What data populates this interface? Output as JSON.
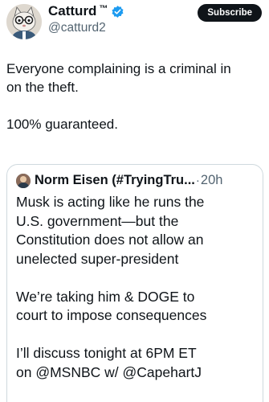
{
  "author": {
    "display_name": "Catturd",
    "trademark": "™",
    "handle": "@catturd2",
    "verified_icon": "verified-badge-icon",
    "avatar_icon": "cat-avatar-icon"
  },
  "subscribe_label": "Subscribe",
  "tweet": {
    "line1": "Everyone complaining is a criminal in",
    "line2": "on the theft.",
    "line3": "100% guaranteed."
  },
  "quote": {
    "author_name": "Norm Eisen (#TryingTru...",
    "dot": "·",
    "time": "20h",
    "avatar_icon": "person-avatar-icon",
    "lines": [
      "Musk is acting like he runs the",
      "U.S. government—but the",
      "Constitution does not allow an",
      "unelected super-president",
      "We’re taking him & DOGE to",
      "court to impose consequences",
      "I’ll discuss tonight at 6PM ET",
      "on @MSNBC w/ @CapehartJ"
    ]
  },
  "colors": {
    "text": "#0f1419",
    "secondary": "#536471",
    "verified": "#1d9bf0",
    "border": "#cfd9de"
  }
}
